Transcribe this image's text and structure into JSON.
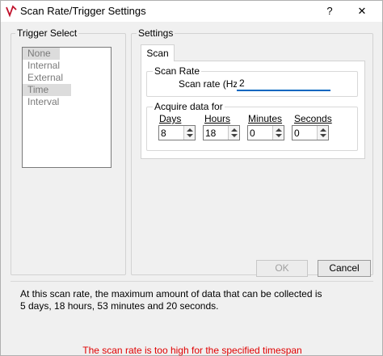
{
  "window": {
    "title": "Scan Rate/Trigger Settings",
    "help": "?",
    "close": "✕"
  },
  "trigger_select": {
    "label": "Trigger Select",
    "items": [
      "None",
      "Internal",
      "External",
      "Time Interval"
    ],
    "selected": "None"
  },
  "settings": {
    "label": "Settings",
    "tab": "Scan",
    "scan_rate": {
      "group_label": "Scan Rate",
      "field_label": "Scan rate (Hz)",
      "value": "2"
    },
    "acquire": {
      "group_label": "Acquire data for",
      "days_label": "Days",
      "days_value": "8",
      "hours_label": "Hours",
      "hours_value": "18",
      "minutes_label": "Minutes",
      "minutes_value": "0",
      "seconds_label": "Seconds",
      "seconds_value": "0"
    }
  },
  "buttons": {
    "ok": "OK",
    "cancel": "Cancel"
  },
  "info": {
    "line1": "At this scan rate, the maximum amount of data that can be collected is",
    "line2": "5 days, 18 hours, 53 minutes and 20 seconds."
  },
  "error": "The scan rate is too high for the specified timespan",
  "colors": {
    "accent": "#0067c0",
    "error": "#e00000",
    "disabled_text": "#a0a0a0"
  }
}
